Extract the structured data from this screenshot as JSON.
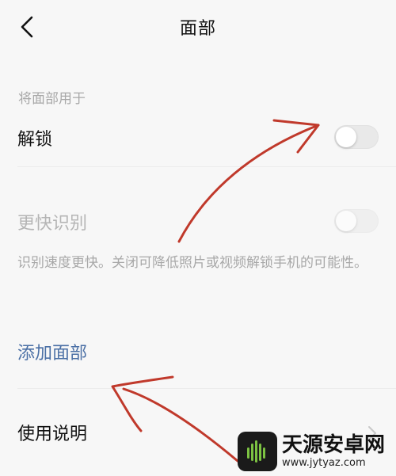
{
  "header": {
    "title": "面部"
  },
  "section_label": "将面部用于",
  "rows": {
    "unlock": {
      "label": "解锁",
      "toggle_on": false
    },
    "faster_recognition": {
      "label": "更快识别",
      "toggle_on": false,
      "disabled": true
    }
  },
  "description": "识别速度更快。关闭可降低照片或视频解锁手机的可能性。",
  "add_face_link": "添加面部",
  "instructions_row": {
    "label": "使用说明"
  },
  "watermark": {
    "name": "天源安卓网",
    "url": "www.jytyaz.com"
  },
  "colors": {
    "link": "#4a6fa5",
    "annotation": "#c0392b",
    "secondary_text": "#a8a8a8"
  }
}
